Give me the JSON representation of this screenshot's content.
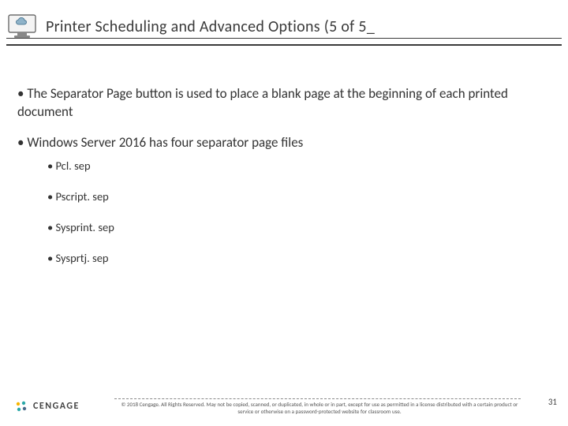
{
  "header": {
    "title": "Printer Scheduling and Advanced Options (5 of 5_"
  },
  "bullets": [
    "The Separator Page button is used to place a blank page at the beginning of each printed document",
    "Windows Server 2016 has four separator page files"
  ],
  "subbullets": [
    "Pcl. sep",
    "Pscript. sep",
    "Sysprint. sep",
    "Sysprtj. sep"
  ],
  "footer": {
    "brand": "CENGAGE",
    "copyright": "© 2018 Cengage. All Rights Reserved. May not be copied, scanned, or duplicated, in whole or in part, except for use as permitted in a license distributed with a certain product or service or otherwise on a password-protected website for classroom use.",
    "page": "31"
  }
}
